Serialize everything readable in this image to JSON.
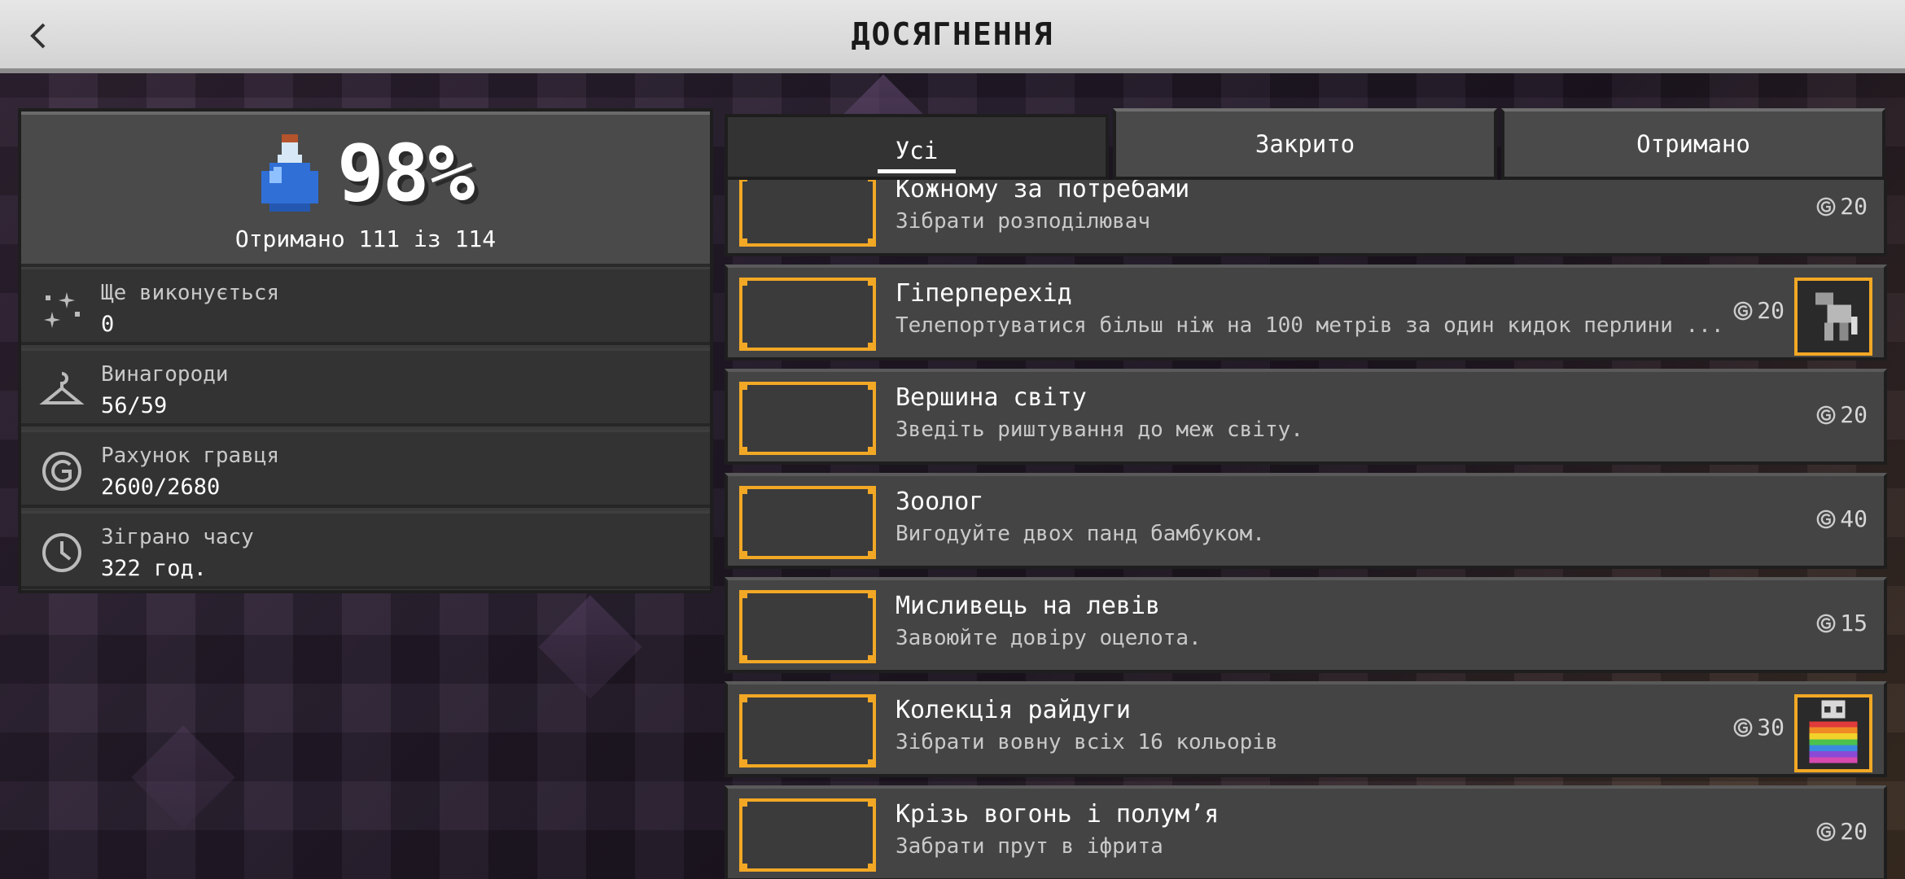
{
  "header": {
    "title": "ДОСЯГНЕННЯ",
    "back_icon": "chevron-left-icon"
  },
  "summary": {
    "percent": "98%",
    "earned_text": "Отримано 111 із 114",
    "icon": "potion-icon",
    "potion_color": "#3a7de0"
  },
  "stats": [
    {
      "label": "Ще виконується",
      "value": "0",
      "icon": "sparkles-icon"
    },
    {
      "label": "Винагороди",
      "value": "56/59",
      "icon": "hanger-icon"
    },
    {
      "label": "Рахунок гравця",
      "value": "2600/2680",
      "icon": "gamerscore-icon"
    },
    {
      "label": "Зіграно часу",
      "value": "322 год.",
      "icon": "clock-icon"
    }
  ],
  "tabs": [
    {
      "label": "Усі",
      "active": true
    },
    {
      "label": "Закрито",
      "active": false
    },
    {
      "label": "Отримано",
      "active": false
    }
  ],
  "achievements": [
    {
      "title": "Кожному за потребами",
      "description": "Зібрати розподілювач",
      "score": "20",
      "reward": false
    },
    {
      "title": "Гіперперехід",
      "description": "Телепортуватися більш ніж на 100 метрів за один кидок перлини ...",
      "score": "20",
      "reward": true,
      "reward_icon": "armor-stand-icon"
    },
    {
      "title": "Вершина світу",
      "description": "Зведіть риштування до меж світу.",
      "score": "20",
      "reward": false
    },
    {
      "title": "Зоолог",
      "description": "Вигодуйте двох панд бамбуком.",
      "score": "40",
      "reward": false
    },
    {
      "title": "Мисливець на левів",
      "description": "Завоюйте довіру оцелота.",
      "score": "15",
      "reward": false
    },
    {
      "title": "Колекція райдуги",
      "description": "Зібрати вовну всіх 16 кольорів",
      "score": "30",
      "reward": true,
      "reward_icon": "rainbow-cape-icon"
    },
    {
      "title": "Крізь вогонь і полум’я",
      "description": "Забрати прут в іфрита",
      "score": "20",
      "reward": false
    }
  ],
  "colors": {
    "accent_gold": "#f2a825",
    "panel": "#444444",
    "header_bg": "#e0e0e0"
  }
}
